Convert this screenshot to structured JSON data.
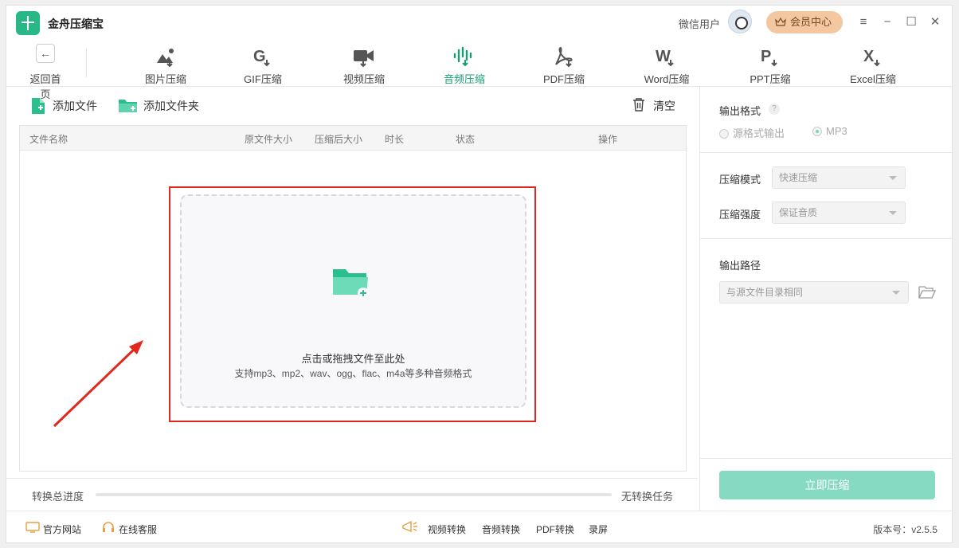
{
  "app": {
    "title": "金舟压缩宝"
  },
  "header": {
    "user_label": "微信用户",
    "vip_label": "会员中心"
  },
  "nav": {
    "back_label": "返回首页",
    "tabs": [
      {
        "label": "图片压缩",
        "icon": "image-icon",
        "active": false
      },
      {
        "label": "GIF压缩",
        "icon": "gif-icon",
        "active": false
      },
      {
        "label": "视频压缩",
        "icon": "video-icon",
        "active": false
      },
      {
        "label": "音频压缩",
        "icon": "audio-icon",
        "active": true
      },
      {
        "label": "PDF压缩",
        "icon": "pdf-icon",
        "active": false
      },
      {
        "label": "Word压缩",
        "icon": "word-icon",
        "active": false
      },
      {
        "label": "PPT压缩",
        "icon": "ppt-icon",
        "active": false
      },
      {
        "label": "Excel压缩",
        "icon": "excel-icon",
        "active": false
      }
    ]
  },
  "toolbar": {
    "add_file": "添加文件",
    "add_folder": "添加文件夹",
    "clear": "清空"
  },
  "table": {
    "columns": [
      "文件名称",
      "原文件大小",
      "压缩后大小",
      "时长",
      "状态",
      "操作"
    ]
  },
  "dropzone": {
    "main_text": "点击或拖拽文件至此处",
    "sub_text": "支持mp3、mp2、wav、ogg、flac、m4a等多种音频格式"
  },
  "progress": {
    "label": "转换总进度",
    "status": "无转换任务",
    "value": 0
  },
  "settings": {
    "output_format_label": "输出格式",
    "help_mark": "?",
    "format_options": [
      {
        "label": "源格式输出",
        "selected": false
      },
      {
        "label": "MP3",
        "selected": true
      }
    ],
    "mode_label": "压缩模式",
    "mode_value": "快速压缩",
    "strength_label": "压缩强度",
    "strength_value": "保证音质",
    "output_path_label": "输出路径",
    "output_path_value": "与源文件目录相同",
    "compress_button": "立即压缩"
  },
  "footer": {
    "website": "官方网站",
    "support": "在线客服",
    "links": [
      "视频转换",
      "音频转换",
      "PDF转换",
      "录屏"
    ],
    "version": "版本号：v2.5.5"
  },
  "colors": {
    "accent": "#28b888",
    "active_tab": "#1a9e74",
    "button": "#86dac2",
    "highlight": "#e0281c"
  }
}
